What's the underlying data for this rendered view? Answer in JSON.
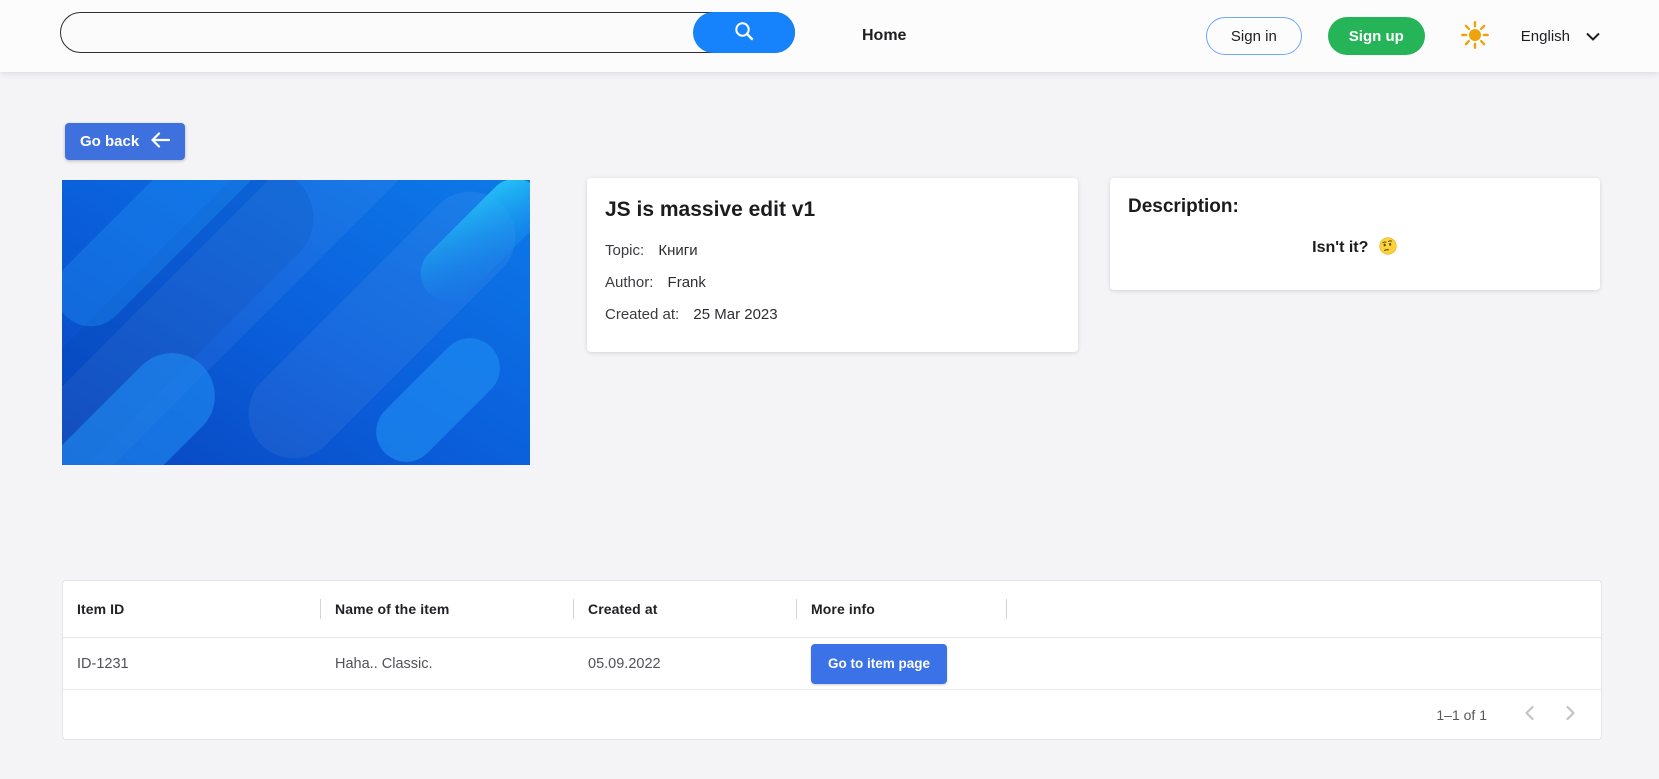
{
  "header": {
    "search": {
      "value": "",
      "placeholder": ""
    },
    "home_label": "Home",
    "sign_in_label": "Sign in",
    "sign_up_label": "Sign up",
    "theme_icon": "sun-icon",
    "language": {
      "selected": "English",
      "chevron_icon": "chevron-down-icon"
    }
  },
  "go_back": {
    "label": "Go back",
    "icon": "arrow-left-icon"
  },
  "item_details": {
    "title": "JS is massive edit v1",
    "topic_label": "Topic:",
    "topic_value": "Книги",
    "author_label": "Author:",
    "author_value": "Frank",
    "created_label": "Created at:",
    "created_value": "25 Mar 2023"
  },
  "description": {
    "heading": "Description:",
    "body": "Isn't it?",
    "emoji": "🤔",
    "emoji_icon": "thinking-face-emoji"
  },
  "items_table": {
    "columns": [
      "Item ID",
      "Name of the item",
      "Created at",
      "More info"
    ],
    "rows": [
      {
        "item_id": "ID-1231",
        "name": "Haha.. Classic.",
        "created_at": "05.09.2022",
        "action_label": "Go to item page"
      }
    ],
    "pagination": {
      "range_label": "1–1 of 1"
    }
  },
  "colors": {
    "search_accent_blue": "#1682fc",
    "button_blue": "#3e71de",
    "sign_up_green": "#25b457",
    "sun_orange": "#f0a30a",
    "page_background": "#f4f4f6"
  }
}
